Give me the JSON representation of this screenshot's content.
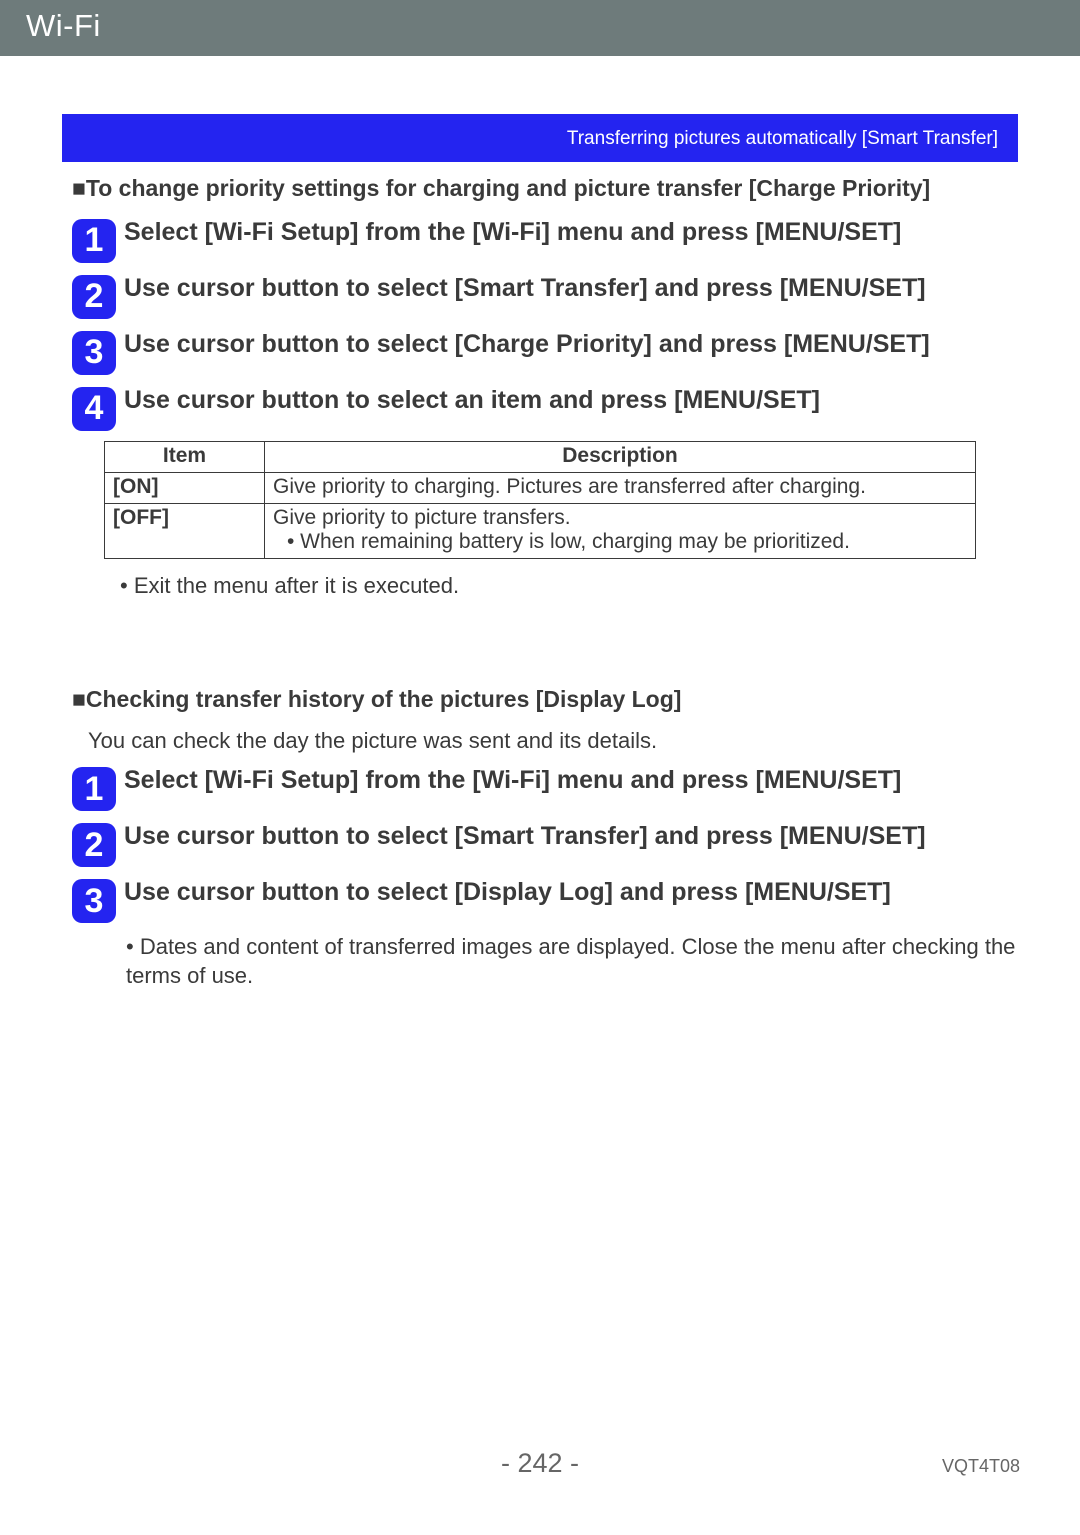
{
  "header": {
    "title": "Wi-Fi"
  },
  "banner": {
    "text": "Transferring pictures automatically  [Smart Transfer]"
  },
  "section1": {
    "heading": "■To change priority settings for charging and picture transfer [Charge Priority]",
    "steps": [
      {
        "n": "1",
        "text": "Select [Wi-Fi Setup] from the [Wi-Fi] menu and press [MENU/SET]"
      },
      {
        "n": "2",
        "text": "Use cursor button to select [Smart Transfer] and press [MENU/SET]"
      },
      {
        "n": "3",
        "text": "Use cursor button to select [Charge Priority] and press [MENU/SET]"
      },
      {
        "n": "4",
        "text": "Use cursor button to select an item and press [MENU/SET]"
      }
    ],
    "table": {
      "head_item": "Item",
      "head_desc": "Description",
      "rows": [
        {
          "item": "[ON]",
          "desc": "Give priority to charging. Pictures are transferred after charging."
        },
        {
          "item": "[OFF]",
          "desc": "Give priority to picture transfers.",
          "sub": "• When remaining battery is low, charging may be prioritized."
        }
      ]
    },
    "exit_note": "• Exit the menu after it is executed."
  },
  "section2": {
    "heading": "■Checking transfer history of the pictures [Display Log]",
    "sub": "You can check the day the picture was sent and its details.",
    "steps": [
      {
        "n": "1",
        "text": "Select [Wi-Fi Setup] from the [Wi-Fi] menu and press [MENU/SET]"
      },
      {
        "n": "2",
        "text": "Use cursor button to select [Smart Transfer] and press [MENU/SET]"
      },
      {
        "n": "3",
        "text": "Use cursor button to select [Display Log] and press [MENU/SET]"
      }
    ],
    "footnote": "• Dates and content of transferred images are displayed. Close the menu after checking the terms of use."
  },
  "footer": {
    "page": "- 242 -",
    "docid": "VQT4T08"
  }
}
